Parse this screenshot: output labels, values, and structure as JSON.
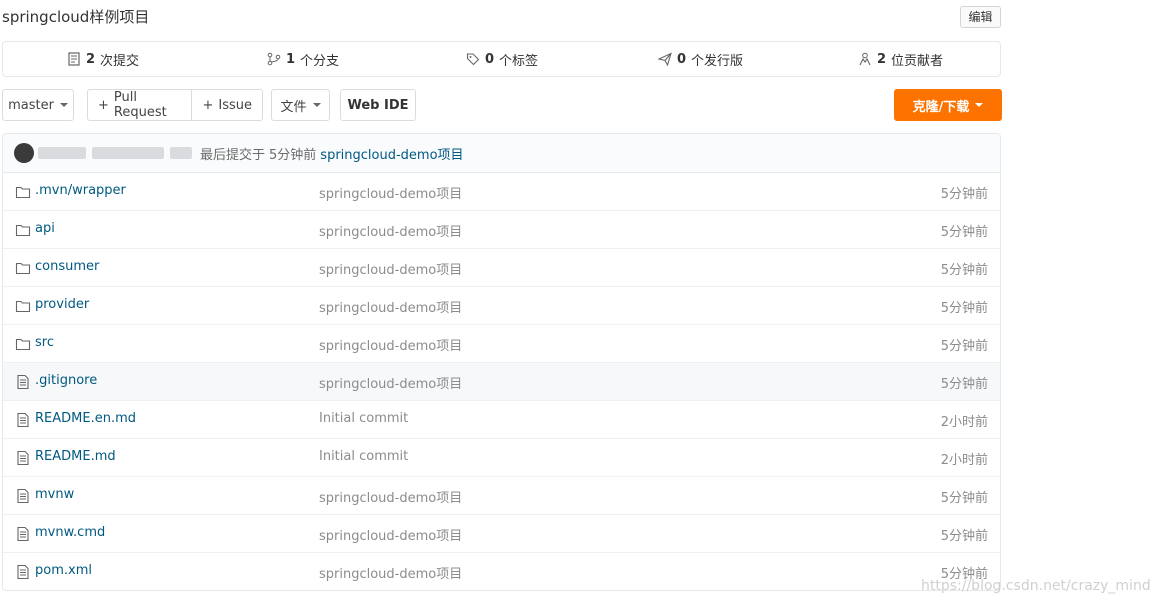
{
  "header": {
    "title": "springcloud样例项目",
    "edit_label": "编辑"
  },
  "stats": [
    {
      "icon": "commit-icon",
      "count": "2",
      "label": "次提交"
    },
    {
      "icon": "branch-icon",
      "count": "1",
      "label": "个分支"
    },
    {
      "icon": "tag-icon",
      "count": "0",
      "label": "个标签"
    },
    {
      "icon": "release-icon",
      "count": "0",
      "label": "个发行版"
    },
    {
      "icon": "contributors-icon",
      "count": "2",
      "label": "位贡献者"
    }
  ],
  "toolbar": {
    "branch": "master",
    "pull_request": "Pull Request",
    "issue": "Issue",
    "plus": "+",
    "files": "文件",
    "web_ide": "Web IDE",
    "clone": "克隆/下载"
  },
  "commit": {
    "prefix": "最后提交于",
    "time": "5分钟前",
    "message": "springcloud-demo项目"
  },
  "files": [
    {
      "type": "folder",
      "name": ".mvn/wrapper",
      "message": "springcloud-demo项目",
      "time": "5分钟前"
    },
    {
      "type": "folder",
      "name": "api",
      "message": "springcloud-demo项目",
      "time": "5分钟前"
    },
    {
      "type": "folder",
      "name": "consumer",
      "message": "springcloud-demo项目",
      "time": "5分钟前"
    },
    {
      "type": "folder",
      "name": "provider",
      "message": "springcloud-demo项目",
      "time": "5分钟前"
    },
    {
      "type": "folder",
      "name": "src",
      "message": "springcloud-demo项目",
      "time": "5分钟前"
    },
    {
      "type": "file",
      "name": ".gitignore",
      "message": "springcloud-demo项目",
      "time": "5分钟前"
    },
    {
      "type": "file",
      "name": "README.en.md",
      "message": "Initial commit",
      "time": "2小时前"
    },
    {
      "type": "file",
      "name": "README.md",
      "message": "Initial commit",
      "time": "2小时前"
    },
    {
      "type": "file",
      "name": "mvnw",
      "message": "springcloud-demo项目",
      "time": "5分钟前"
    },
    {
      "type": "file",
      "name": "mvnw.cmd",
      "message": "springcloud-demo项目",
      "time": "5分钟前"
    },
    {
      "type": "file",
      "name": "pom.xml",
      "message": "springcloud-demo项目",
      "time": "5分钟前"
    }
  ],
  "watermark": "https://blog.csdn.net/crazy_mind",
  "colors": {
    "accent": "#fe7300",
    "link": "#005980",
    "muted": "#8c8c8c"
  }
}
